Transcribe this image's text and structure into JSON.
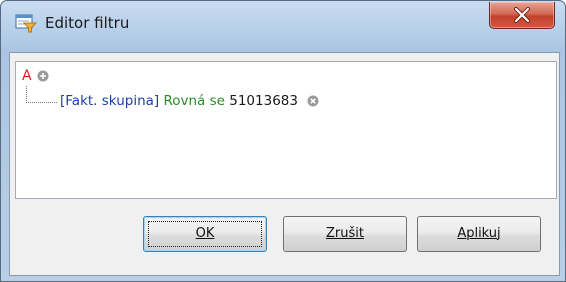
{
  "window": {
    "title": "Editor filtru",
    "title_icon": "filter-editor-icon",
    "close_icon": "close-icon"
  },
  "filter": {
    "root_operator": "A",
    "add_icon": "add-circle-icon",
    "condition": {
      "field": "[Fakt. skupina]",
      "operator": "Rovná se",
      "value": "51013683",
      "remove_icon": "remove-circle-icon"
    },
    "colors": {
      "operator_root": "#e02020",
      "field": "#1e3fa8",
      "condition_operator": "#2e8a2e"
    }
  },
  "buttons": {
    "ok_label": "OK",
    "cancel_label": "Zrušit",
    "apply_label": "Aplikuj"
  }
}
